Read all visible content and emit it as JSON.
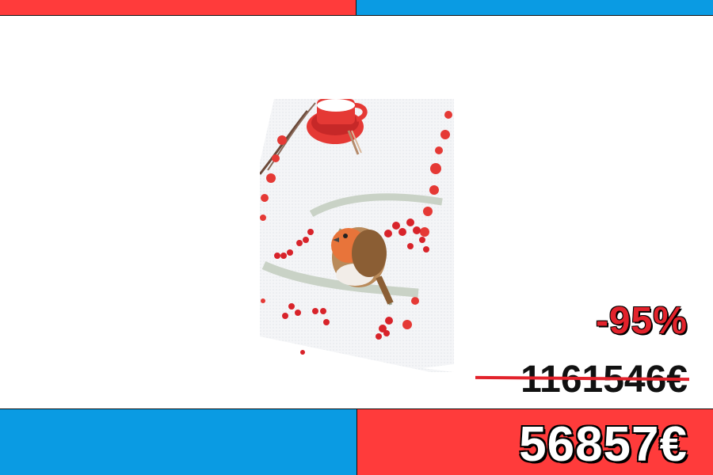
{
  "banner": {
    "top_left_color": "#ff3b3b",
    "top_right_color": "#0a9be3",
    "bottom_left_color": "#0a9be3",
    "bottom_right_color": "#ff3b3b"
  },
  "product": {
    "image": "robin-cross-stitch-table-runner"
  },
  "pricing": {
    "discount": "-95%",
    "old_price": "1161546€",
    "new_price": "56857€",
    "accent_color": "#e2222b"
  }
}
